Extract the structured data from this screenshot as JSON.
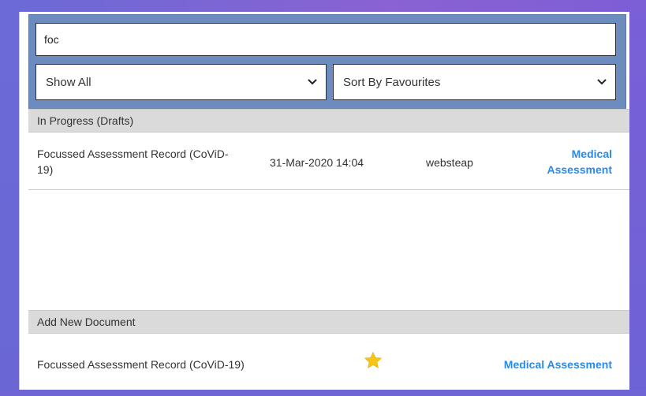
{
  "search": {
    "value": "foc"
  },
  "filters": {
    "show": {
      "selected": "Show All"
    },
    "sort": {
      "selected": "Sort By Favourites"
    }
  },
  "sections": {
    "drafts": {
      "title": "In Progress (Drafts)",
      "items": [
        {
          "title": "Focussed Assessment Record (CoViD-19)",
          "date": "31-Mar-2020 14:04",
          "user": "websteap",
          "category": "Medical Assessment"
        }
      ]
    },
    "add_new": {
      "title": "Add New Document",
      "items": [
        {
          "title": "Focussed Assessment Record (CoViD-19)",
          "favourite_icon": "star-icon",
          "category": "Medical Assessment"
        }
      ]
    }
  },
  "colors": {
    "accent_link": "#2a8ae8",
    "search_area": "#6c8cc0",
    "section_header": "#dadada",
    "star": "#f5c518"
  }
}
